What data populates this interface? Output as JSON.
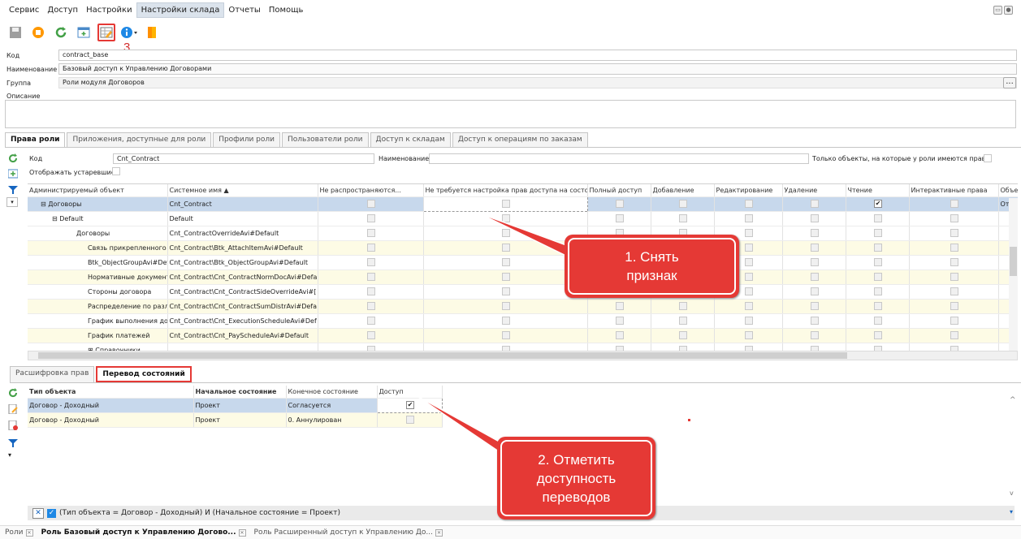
{
  "menu": [
    "Сервис",
    "Доступ",
    "Настройки",
    "Настройки склада",
    "Отчеты",
    "Помощь"
  ],
  "toolbar_icons": [
    "save-icon",
    "stop-icon",
    "refresh-icon",
    "window-add-icon",
    "edit-table-icon",
    "info-icon",
    "exit-door-icon"
  ],
  "callout3": "3",
  "form": {
    "code_label": "Код",
    "code_value": "contract_base",
    "name_label": "Наименование",
    "name_value": "Базовый доступ к Управлению Договорами",
    "group_label": "Группа",
    "group_value": "Роли модуля Договоров",
    "desc_label": "Описание",
    "more": "..."
  },
  "tabs": [
    "Права роли",
    "Приложения, доступные для роли",
    "Профили роли",
    "Пользователи роли",
    "Доступ к складам",
    "Доступ к операциям по заказам"
  ],
  "filters": {
    "code_label": "Код",
    "code_value": "Cnt_Contract",
    "name_label": "Наименование",
    "only_label": "Только объекты, на которые у роли имеются права",
    "obsolete_label": "Отображать устаревшие"
  },
  "grid": {
    "headers": [
      "Администрируемый объект",
      "Системное имя ▲",
      "Не распространяются...",
      "Не требуется настройка прав доступа на состо...",
      "Полный доступ",
      "Добавление",
      "Редактирование",
      "Удаление",
      "Чтение",
      "Интерактивные права",
      "Объектные пр"
    ],
    "rows": [
      {
        "obj": "⊟ Договоры",
        "sys": "Cnt_Contract",
        "extra": "Отсутствую"
      },
      {
        "obj": "⊟ Default",
        "sys": "Default",
        "extra": ""
      },
      {
        "obj": "Договоры",
        "sys": "Cnt_ContractOverrideAvi#Default",
        "extra": ""
      },
      {
        "obj": "Связь прикрепленного",
        "sys": "Cnt_Contract\\Btk_AttachItemAvi#Default",
        "extra": ""
      },
      {
        "obj": "Btk_ObjectGroupAvi#Def",
        "sys": "Cnt_Contract\\Btk_ObjectGroupAvi#Default",
        "extra": ""
      },
      {
        "obj": "Нормативные документ",
        "sys": "Cnt_Contract\\Cnt_ContractNormDocAvi#Defa",
        "extra": ""
      },
      {
        "obj": "Стороны договора",
        "sys": "Cnt_Contract\\Cnt_ContractSideOverrideAvi#[",
        "extra": ""
      },
      {
        "obj": "Распределение по разл",
        "sys": "Cnt_Contract\\Cnt_ContractSumDistrAvi#Defa",
        "extra": ""
      },
      {
        "obj": "График выполнения до",
        "sys": "Cnt_Contract\\Cnt_ExecutionScheduleAvi#Def",
        "extra": ""
      },
      {
        "obj": "График платежей",
        "sys": "Cnt_Contract\\Cnt_PayScheduleAvi#Default",
        "extra": ""
      },
      {
        "obj": "⊞ Справочники",
        "sys": "",
        "extra": ""
      }
    ]
  },
  "bottom_tabs": [
    "Расшифровка прав",
    "Перевод состояний"
  ],
  "grid2": {
    "headers": [
      "Тип объекта",
      "Начальное состояние",
      "Конечное состояние",
      "Доступ"
    ],
    "rows": [
      {
        "type": "Договор - Доходный",
        "start": "Проект",
        "end": "Согласуется",
        "access": "✔"
      },
      {
        "type": "Договор - Доходный",
        "start": "Проект",
        "end": "0. Аннулирован",
        "access": ""
      }
    ]
  },
  "filter_expr": "(Тип объекта = Договор - Доходный) И (Начальное состояние = Проект)",
  "callouts": {
    "c1_line1": "1. Снять",
    "c1_line2": "признак",
    "c2_line1": "2. Отметить",
    "c2_line2": "доступность",
    "c2_line3": "переводов"
  },
  "doc_tabs": [
    "Роли",
    "Роль Базовый доступ к Управлению Догово...",
    "Роль Расширенный доступ к Управлению До..."
  ],
  "colors": {
    "highlight": "#e53935",
    "selected": "#c7d8ec",
    "yellow_row": "#fdfbe5"
  }
}
